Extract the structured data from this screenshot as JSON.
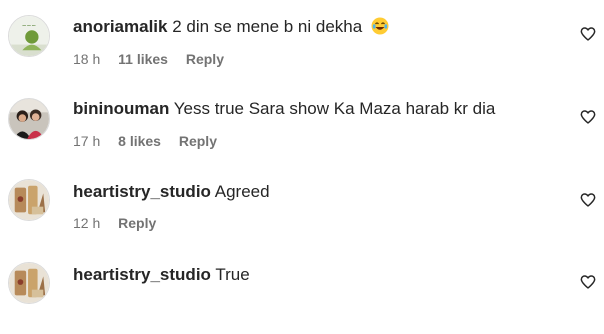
{
  "comments": [
    {
      "username": "anoriamalik",
      "text": "2 din se mene b ni dekha",
      "emoji": "😂",
      "time": "18 h",
      "likes": "11 likes",
      "reply": "Reply"
    },
    {
      "username": "bininouman",
      "text": "Yess true Sara show Ka Maza harab kr dia",
      "time": "17 h",
      "likes": "8 likes",
      "reply": "Reply"
    },
    {
      "username": "heartistry_studio",
      "text": "Agreed",
      "time": "12 h",
      "reply": "Reply"
    },
    {
      "username": "heartistry_studio",
      "text": "True"
    }
  ],
  "icons": {
    "like": "heart-outline-icon",
    "emoji": "face-with-tears-of-joy"
  },
  "colors": {
    "primary_text": "#262626",
    "secondary_text": "#737373"
  }
}
